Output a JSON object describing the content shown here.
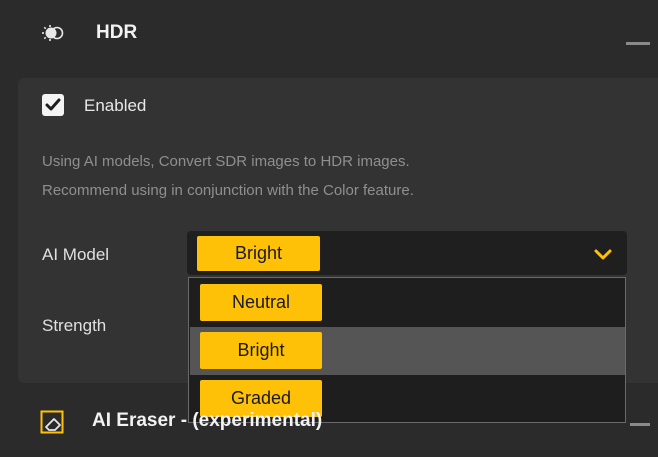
{
  "hdr": {
    "title": "HDR",
    "icon": "hdr-icon",
    "enabled_label": "Enabled",
    "enabled": true,
    "description_line1": "Using AI models, Convert SDR images to HDR images.",
    "description_line2": "Recommend using in conjunction with the Color feature.",
    "ai_model_label": "AI Model",
    "ai_model_value": "Bright",
    "strength_label": "Strength",
    "dropdown_options": [
      {
        "label": "Neutral"
      },
      {
        "label": "Bright",
        "highlighted": true
      },
      {
        "label": "Graded"
      }
    ]
  },
  "eraser": {
    "title": "AI Eraser - (experimental)",
    "icon": "eraser-icon"
  },
  "colors": {
    "accent": "#ffc107",
    "background": "#2b2b2b",
    "panel": "#333333"
  }
}
